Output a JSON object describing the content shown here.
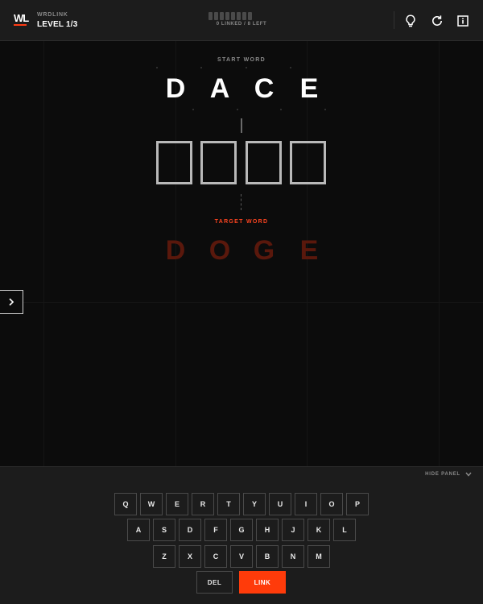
{
  "header": {
    "brand_mark": "WL",
    "brand_name": "WRDLINK",
    "level": "LEVEL 1/3",
    "progress_segments": 8,
    "progress_filled": 0,
    "progress_text": "0 LINKED  /  8 LEFT",
    "accent": "#ff3b14"
  },
  "game": {
    "start_label": "START WORD",
    "start_word": [
      "D",
      "A",
      "C",
      "E"
    ],
    "input_slots": [
      "",
      "",
      "",
      ""
    ],
    "target_label": "TARGET WORD",
    "target_word": [
      "D",
      "O",
      "G",
      "E"
    ]
  },
  "icons": {
    "hint": "lightbulb-icon",
    "restart": "refresh-icon",
    "info": "info-icon",
    "side_toggle": "chevron-right-icon",
    "hide_panel": "chevron-down-icon"
  },
  "keyboard": {
    "hide_label": "HIDE PANEL",
    "rows": [
      [
        "Q",
        "W",
        "E",
        "R",
        "T",
        "Y",
        "U",
        "I",
        "O",
        "P"
      ],
      [
        "A",
        "S",
        "D",
        "F",
        "G",
        "H",
        "J",
        "K",
        "L"
      ],
      [
        "Z",
        "X",
        "C",
        "V",
        "B",
        "N",
        "M"
      ]
    ],
    "del_label": "DEL",
    "link_label": "LINK",
    "link_color": "#ff3b0a"
  }
}
